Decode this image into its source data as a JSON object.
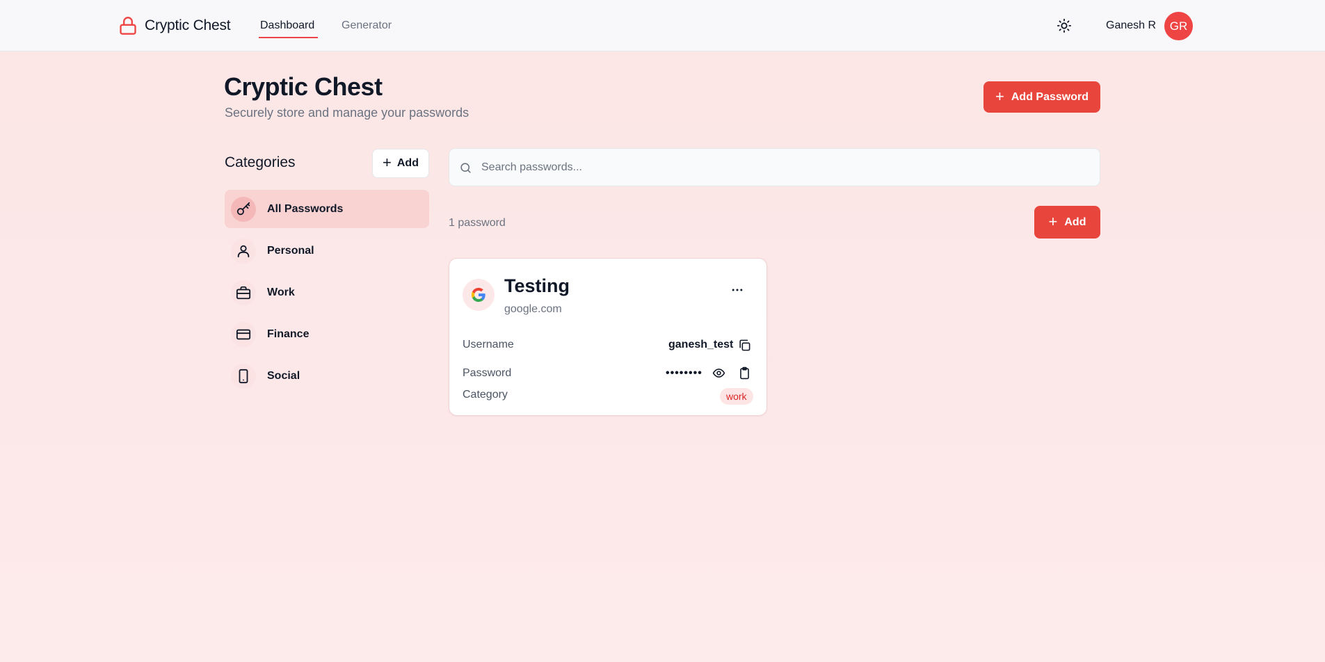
{
  "app": {
    "brand": "Cryptic Chest",
    "accent_color": "#ef4444"
  },
  "nav": {
    "links": [
      {
        "label": "Dashboard",
        "active": true
      },
      {
        "label": "Generator",
        "active": false
      }
    ],
    "theme_icon": "sun-icon",
    "user_name": "Ganesh R",
    "avatar_initials": "GR"
  },
  "header": {
    "title": "Cryptic Chest",
    "subtitle": "Securely store and manage your passwords",
    "add_password_label": "Add Password"
  },
  "categories": {
    "heading": "Categories",
    "add_label": "Add",
    "items": [
      {
        "label": "All Passwords",
        "icon": "key-icon",
        "active": true
      },
      {
        "label": "Personal",
        "icon": "user-icon",
        "active": false
      },
      {
        "label": "Work",
        "icon": "briefcase-icon",
        "active": false
      },
      {
        "label": "Finance",
        "icon": "credit-card-icon",
        "active": false
      },
      {
        "label": "Social",
        "icon": "smartphone-icon",
        "active": false
      }
    ]
  },
  "search": {
    "placeholder": "Search passwords...",
    "value": ""
  },
  "list": {
    "count_text": "1 password",
    "add_label": "Add"
  },
  "passwords": [
    {
      "title": "Testing",
      "domain": "google.com",
      "logo": "google-logo-icon",
      "username_label": "Username",
      "username": "ganesh_test",
      "password_label": "Password",
      "password_masked": "••••••••",
      "category_label": "Category",
      "category": "work"
    }
  ]
}
